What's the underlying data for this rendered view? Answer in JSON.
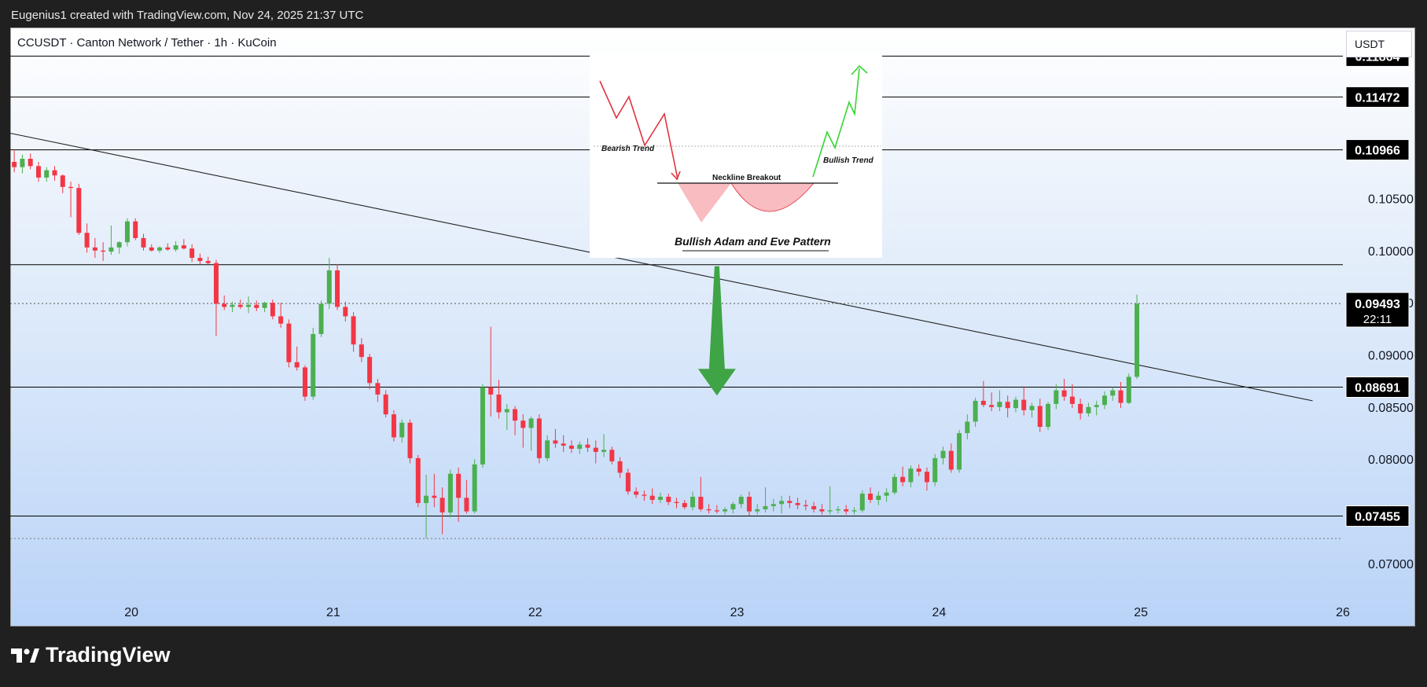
{
  "header": {
    "attribution": "Eugenius1 created with TradingView.com, Nov 24, 2025 21:37 UTC"
  },
  "chart_header": {
    "symbol_line": "CCUSDT · Canton Network / Tether · 1h · KuCoin",
    "currency": "USDT"
  },
  "inset": {
    "bearish_label": "Bearish Trend",
    "bullish_label": "Bullish Trend",
    "neckline_label": "Neckline Breakout",
    "title": "Bullish Adam and Eve Pattern"
  },
  "footer": {
    "brand": "TradingView"
  },
  "chart_data": {
    "type": "candlestick",
    "symbol": "CCUSDT",
    "interval": "1h",
    "exchange": "KuCoin",
    "quote_currency": "USDT",
    "ylim": [
      0.066,
      0.1195
    ],
    "xlim": [
      19.4,
      26.0
    ],
    "y_ticks": [
      0.07,
      0.08,
      0.085,
      0.09,
      0.095,
      0.1,
      0.105
    ],
    "y_tick_labels": [
      "0.07000",
      "0.08000",
      "0.08500",
      "0.09000",
      "0.09500",
      "0.10000",
      "0.10500"
    ],
    "x_ticks": [
      20,
      21,
      22,
      23,
      24,
      25,
      26
    ],
    "x_tick_labels": [
      "20",
      "21",
      "22",
      "23",
      "24",
      "25",
      "26"
    ],
    "horizontal_levels": [
      {
        "price": 0.11864,
        "label": "0.11864"
      },
      {
        "price": 0.11472,
        "label": "0.11472"
      },
      {
        "price": 0.10966,
        "label": "0.10966"
      },
      {
        "price": 0.09865,
        "label": ""
      },
      {
        "price": 0.08691,
        "label": "0.08691"
      },
      {
        "price": 0.07455,
        "label": "0.07455"
      }
    ],
    "current_price": {
      "price": 0.09493,
      "label": "0.09493",
      "countdown": "22:11"
    },
    "trendline": {
      "x1": 19.4,
      "y1": 0.11125,
      "x2": 25.85,
      "y2": 0.0856
    },
    "arrow": {
      "x": 22.9,
      "from": 0.0985,
      "to": 0.0861,
      "color": "#3fa445"
    },
    "colors": {
      "up": "#4caf50",
      "down": "#f23645",
      "level_line": "#000000",
      "arrow": "#3fa445"
    },
    "candles": [
      {
        "t": 19.42,
        "o": 0.1085,
        "h": 0.1096,
        "l": 0.1075,
        "c": 0.108
      },
      {
        "t": 19.46,
        "o": 0.108,
        "h": 0.1092,
        "l": 0.1074,
        "c": 0.1088
      },
      {
        "t": 19.5,
        "o": 0.1088,
        "h": 0.1093,
        "l": 0.1078,
        "c": 0.1081
      },
      {
        "t": 19.54,
        "o": 0.1081,
        "h": 0.1085,
        "l": 0.1066,
        "c": 0.107
      },
      {
        "t": 19.58,
        "o": 0.107,
        "h": 0.108,
        "l": 0.1066,
        "c": 0.1077
      },
      {
        "t": 19.62,
        "o": 0.1077,
        "h": 0.1081,
        "l": 0.1067,
        "c": 0.1072
      },
      {
        "t": 19.66,
        "o": 0.1072,
        "h": 0.1073,
        "l": 0.1055,
        "c": 0.1061
      },
      {
        "t": 19.7,
        "o": 0.1061,
        "h": 0.1066,
        "l": 0.1032,
        "c": 0.106
      },
      {
        "t": 19.74,
        "o": 0.106,
        "h": 0.1064,
        "l": 0.1015,
        "c": 0.1017
      },
      {
        "t": 19.78,
        "o": 0.1017,
        "h": 0.1026,
        "l": 0.0998,
        "c": 0.1003
      },
      {
        "t": 19.82,
        "o": 0.1003,
        "h": 0.1012,
        "l": 0.0993,
        "c": 0.1
      },
      {
        "t": 19.86,
        "o": 0.1,
        "h": 0.1008,
        "l": 0.099,
        "c": 0.0999
      },
      {
        "t": 19.9,
        "o": 0.0999,
        "h": 0.1024,
        "l": 0.0996,
        "c": 0.1003
      },
      {
        "t": 19.94,
        "o": 0.1003,
        "h": 0.1009,
        "l": 0.0997,
        "c": 0.1008
      },
      {
        "t": 19.98,
        "o": 0.1008,
        "h": 0.1031,
        "l": 0.1004,
        "c": 0.1028
      },
      {
        "t": 20.02,
        "o": 0.1028,
        "h": 0.1031,
        "l": 0.101,
        "c": 0.1012
      },
      {
        "t": 20.06,
        "o": 0.1012,
        "h": 0.1016,
        "l": 0.1,
        "c": 0.1003
      },
      {
        "t": 20.1,
        "o": 0.1003,
        "h": 0.1006,
        "l": 0.0999,
        "c": 0.1
      },
      {
        "t": 20.14,
        "o": 0.1,
        "h": 0.1004,
        "l": 0.0998,
        "c": 0.1003
      },
      {
        "t": 20.18,
        "o": 0.1003,
        "h": 0.1007,
        "l": 0.1,
        "c": 0.1001
      },
      {
        "t": 20.22,
        "o": 0.1001,
        "h": 0.1009,
        "l": 0.0999,
        "c": 0.1005
      },
      {
        "t": 20.26,
        "o": 0.1005,
        "h": 0.1011,
        "l": 0.1001,
        "c": 0.1002
      },
      {
        "t": 20.3,
        "o": 0.1002,
        "h": 0.1006,
        "l": 0.0989,
        "c": 0.0993
      },
      {
        "t": 20.34,
        "o": 0.0993,
        "h": 0.0997,
        "l": 0.0987,
        "c": 0.099
      },
      {
        "t": 20.38,
        "o": 0.099,
        "h": 0.0994,
        "l": 0.0987,
        "c": 0.0988
      },
      {
        "t": 20.42,
        "o": 0.0988,
        "h": 0.0991,
        "l": 0.0918,
        "c": 0.0949
      },
      {
        "t": 20.46,
        "o": 0.0949,
        "h": 0.0957,
        "l": 0.0943,
        "c": 0.0946
      },
      {
        "t": 20.5,
        "o": 0.0946,
        "h": 0.0951,
        "l": 0.0941,
        "c": 0.0948
      },
      {
        "t": 20.54,
        "o": 0.0948,
        "h": 0.0953,
        "l": 0.0944,
        "c": 0.0946
      },
      {
        "t": 20.58,
        "o": 0.0946,
        "h": 0.0956,
        "l": 0.094,
        "c": 0.0948
      },
      {
        "t": 20.62,
        "o": 0.0948,
        "h": 0.0952,
        "l": 0.0942,
        "c": 0.0945
      },
      {
        "t": 20.66,
        "o": 0.0945,
        "h": 0.0951,
        "l": 0.0941,
        "c": 0.095
      },
      {
        "t": 20.7,
        "o": 0.095,
        "h": 0.0953,
        "l": 0.0934,
        "c": 0.0937
      },
      {
        "t": 20.74,
        "o": 0.0937,
        "h": 0.095,
        "l": 0.0926,
        "c": 0.093
      },
      {
        "t": 20.78,
        "o": 0.093,
        "h": 0.0934,
        "l": 0.0888,
        "c": 0.0893
      },
      {
        "t": 20.82,
        "o": 0.0893,
        "h": 0.0908,
        "l": 0.0885,
        "c": 0.0888
      },
      {
        "t": 20.86,
        "o": 0.0888,
        "h": 0.089,
        "l": 0.0856,
        "c": 0.086
      },
      {
        "t": 20.9,
        "o": 0.086,
        "h": 0.0926,
        "l": 0.0857,
        "c": 0.092
      },
      {
        "t": 20.94,
        "o": 0.092,
        "h": 0.0952,
        "l": 0.0917,
        "c": 0.0949
      },
      {
        "t": 20.98,
        "o": 0.0949,
        "h": 0.0993,
        "l": 0.0944,
        "c": 0.0981
      },
      {
        "t": 21.02,
        "o": 0.0981,
        "h": 0.0987,
        "l": 0.0943,
        "c": 0.0946
      },
      {
        "t": 21.06,
        "o": 0.0946,
        "h": 0.0951,
        "l": 0.0932,
        "c": 0.0937
      },
      {
        "t": 21.1,
        "o": 0.0937,
        "h": 0.0941,
        "l": 0.0903,
        "c": 0.091
      },
      {
        "t": 21.14,
        "o": 0.091,
        "h": 0.0916,
        "l": 0.0893,
        "c": 0.0898
      },
      {
        "t": 21.18,
        "o": 0.0898,
        "h": 0.0901,
        "l": 0.0867,
        "c": 0.0873
      },
      {
        "t": 21.22,
        "o": 0.0873,
        "h": 0.0877,
        "l": 0.0855,
        "c": 0.0862
      },
      {
        "t": 21.26,
        "o": 0.0862,
        "h": 0.0866,
        "l": 0.084,
        "c": 0.0843
      },
      {
        "t": 21.3,
        "o": 0.0843,
        "h": 0.0847,
        "l": 0.0817,
        "c": 0.0821
      },
      {
        "t": 21.34,
        "o": 0.0821,
        "h": 0.0838,
        "l": 0.0816,
        "c": 0.0835
      },
      {
        "t": 21.38,
        "o": 0.0835,
        "h": 0.0838,
        "l": 0.0796,
        "c": 0.0801
      },
      {
        "t": 21.42,
        "o": 0.0801,
        "h": 0.0804,
        "l": 0.0754,
        "c": 0.0758
      },
      {
        "t": 21.46,
        "o": 0.0758,
        "h": 0.0785,
        "l": 0.0724,
        "c": 0.0765
      },
      {
        "t": 21.5,
        "o": 0.0765,
        "h": 0.0786,
        "l": 0.0754,
        "c": 0.0763
      },
      {
        "t": 21.54,
        "o": 0.0763,
        "h": 0.0773,
        "l": 0.0728,
        "c": 0.0749
      },
      {
        "t": 21.58,
        "o": 0.0749,
        "h": 0.079,
        "l": 0.0744,
        "c": 0.0786
      },
      {
        "t": 21.62,
        "o": 0.0786,
        "h": 0.0792,
        "l": 0.074,
        "c": 0.0763
      },
      {
        "t": 21.66,
        "o": 0.0763,
        "h": 0.078,
        "l": 0.0748,
        "c": 0.075
      },
      {
        "t": 21.7,
        "o": 0.075,
        "h": 0.08,
        "l": 0.0748,
        "c": 0.0795
      },
      {
        "t": 21.74,
        "o": 0.0795,
        "h": 0.0872,
        "l": 0.0792,
        "c": 0.0869
      },
      {
        "t": 21.78,
        "o": 0.0869,
        "h": 0.0927,
        "l": 0.0841,
        "c": 0.0862
      },
      {
        "t": 21.82,
        "o": 0.0862,
        "h": 0.0876,
        "l": 0.0839,
        "c": 0.0845
      },
      {
        "t": 21.86,
        "o": 0.0845,
        "h": 0.0853,
        "l": 0.0828,
        "c": 0.0848
      },
      {
        "t": 21.9,
        "o": 0.0848,
        "h": 0.0851,
        "l": 0.0823,
        "c": 0.0837
      },
      {
        "t": 21.94,
        "o": 0.0837,
        "h": 0.0843,
        "l": 0.0811,
        "c": 0.083
      },
      {
        "t": 21.98,
        "o": 0.083,
        "h": 0.0841,
        "l": 0.0808,
        "c": 0.0839
      },
      {
        "t": 22.02,
        "o": 0.0839,
        "h": 0.0843,
        "l": 0.0796,
        "c": 0.0801
      },
      {
        "t": 22.06,
        "o": 0.0801,
        "h": 0.0823,
        "l": 0.0798,
        "c": 0.0818
      },
      {
        "t": 22.1,
        "o": 0.0818,
        "h": 0.0829,
        "l": 0.0811,
        "c": 0.0815
      },
      {
        "t": 22.14,
        "o": 0.0815,
        "h": 0.0823,
        "l": 0.0807,
        "c": 0.0813
      },
      {
        "t": 22.18,
        "o": 0.0813,
        "h": 0.0818,
        "l": 0.0806,
        "c": 0.081
      },
      {
        "t": 22.22,
        "o": 0.081,
        "h": 0.0817,
        "l": 0.0805,
        "c": 0.0814
      },
      {
        "t": 22.26,
        "o": 0.0814,
        "h": 0.082,
        "l": 0.0807,
        "c": 0.0811
      },
      {
        "t": 22.3,
        "o": 0.0811,
        "h": 0.0818,
        "l": 0.0796,
        "c": 0.0807
      },
      {
        "t": 22.34,
        "o": 0.0807,
        "h": 0.0824,
        "l": 0.0802,
        "c": 0.0809
      },
      {
        "t": 22.38,
        "o": 0.0809,
        "h": 0.0812,
        "l": 0.0795,
        "c": 0.0798
      },
      {
        "t": 22.42,
        "o": 0.0798,
        "h": 0.0802,
        "l": 0.0782,
        "c": 0.0787
      },
      {
        "t": 22.46,
        "o": 0.0787,
        "h": 0.0791,
        "l": 0.0766,
        "c": 0.0769
      },
      {
        "t": 22.5,
        "o": 0.0769,
        "h": 0.0773,
        "l": 0.0763,
        "c": 0.0766
      },
      {
        "t": 22.54,
        "o": 0.0766,
        "h": 0.077,
        "l": 0.076,
        "c": 0.0765
      },
      {
        "t": 22.58,
        "o": 0.0765,
        "h": 0.0772,
        "l": 0.0757,
        "c": 0.0761
      },
      {
        "t": 22.62,
        "o": 0.0761,
        "h": 0.0768,
        "l": 0.0758,
        "c": 0.0764
      },
      {
        "t": 22.66,
        "o": 0.0764,
        "h": 0.0767,
        "l": 0.0756,
        "c": 0.0759
      },
      {
        "t": 22.7,
        "o": 0.0759,
        "h": 0.0763,
        "l": 0.0753,
        "c": 0.0758
      },
      {
        "t": 22.74,
        "o": 0.0758,
        "h": 0.0761,
        "l": 0.0752,
        "c": 0.0754
      },
      {
        "t": 22.78,
        "o": 0.0754,
        "h": 0.0769,
        "l": 0.0751,
        "c": 0.0764
      },
      {
        "t": 22.82,
        "o": 0.0764,
        "h": 0.0783,
        "l": 0.075,
        "c": 0.0752
      },
      {
        "t": 22.86,
        "o": 0.0752,
        "h": 0.0757,
        "l": 0.0748,
        "c": 0.0751
      },
      {
        "t": 22.9,
        "o": 0.0751,
        "h": 0.0756,
        "l": 0.0748,
        "c": 0.075
      },
      {
        "t": 22.94,
        "o": 0.075,
        "h": 0.0754,
        "l": 0.0747,
        "c": 0.0752
      },
      {
        "t": 22.98,
        "o": 0.0752,
        "h": 0.0759,
        "l": 0.0748,
        "c": 0.0757
      },
      {
        "t": 23.02,
        "o": 0.0757,
        "h": 0.0766,
        "l": 0.0753,
        "c": 0.0764
      },
      {
        "t": 23.06,
        "o": 0.0764,
        "h": 0.0769,
        "l": 0.0746,
        "c": 0.075
      },
      {
        "t": 23.1,
        "o": 0.075,
        "h": 0.0757,
        "l": 0.0747,
        "c": 0.0752
      },
      {
        "t": 23.14,
        "o": 0.0752,
        "h": 0.0773,
        "l": 0.0749,
        "c": 0.0755
      },
      {
        "t": 23.18,
        "o": 0.0755,
        "h": 0.0762,
        "l": 0.075,
        "c": 0.0757
      },
      {
        "t": 23.22,
        "o": 0.0757,
        "h": 0.0765,
        "l": 0.0748,
        "c": 0.076
      },
      {
        "t": 23.26,
        "o": 0.076,
        "h": 0.0765,
        "l": 0.0753,
        "c": 0.0758
      },
      {
        "t": 23.3,
        "o": 0.0758,
        "h": 0.0763,
        "l": 0.0752,
        "c": 0.0756
      },
      {
        "t": 23.34,
        "o": 0.0756,
        "h": 0.0761,
        "l": 0.0751,
        "c": 0.0755
      },
      {
        "t": 23.38,
        "o": 0.0755,
        "h": 0.0759,
        "l": 0.0749,
        "c": 0.0752
      },
      {
        "t": 23.42,
        "o": 0.0752,
        "h": 0.0757,
        "l": 0.0747,
        "c": 0.075
      },
      {
        "t": 23.46,
        "o": 0.075,
        "h": 0.0774,
        "l": 0.0747,
        "c": 0.0751
      },
      {
        "t": 23.5,
        "o": 0.0751,
        "h": 0.0755,
        "l": 0.0748,
        "c": 0.0752
      },
      {
        "t": 23.54,
        "o": 0.0752,
        "h": 0.0756,
        "l": 0.0747,
        "c": 0.075
      },
      {
        "t": 23.58,
        "o": 0.075,
        "h": 0.0754,
        "l": 0.0747,
        "c": 0.0751
      },
      {
        "t": 23.62,
        "o": 0.0751,
        "h": 0.077,
        "l": 0.0749,
        "c": 0.0767
      },
      {
        "t": 23.66,
        "o": 0.0767,
        "h": 0.0773,
        "l": 0.0758,
        "c": 0.0761
      },
      {
        "t": 23.7,
        "o": 0.0761,
        "h": 0.0769,
        "l": 0.0756,
        "c": 0.0765
      },
      {
        "t": 23.74,
        "o": 0.0765,
        "h": 0.0772,
        "l": 0.0759,
        "c": 0.0768
      },
      {
        "t": 23.78,
        "o": 0.0768,
        "h": 0.0786,
        "l": 0.0766,
        "c": 0.0783
      },
      {
        "t": 23.82,
        "o": 0.0783,
        "h": 0.0793,
        "l": 0.0774,
        "c": 0.0778
      },
      {
        "t": 23.86,
        "o": 0.0778,
        "h": 0.0794,
        "l": 0.0773,
        "c": 0.0791
      },
      {
        "t": 23.9,
        "o": 0.0791,
        "h": 0.0795,
        "l": 0.0784,
        "c": 0.0788
      },
      {
        "t": 23.94,
        "o": 0.0788,
        "h": 0.0792,
        "l": 0.077,
        "c": 0.0778
      },
      {
        "t": 23.98,
        "o": 0.0778,
        "h": 0.0805,
        "l": 0.0774,
        "c": 0.0801
      },
      {
        "t": 24.02,
        "o": 0.0801,
        "h": 0.0812,
        "l": 0.0795,
        "c": 0.0808
      },
      {
        "t": 24.06,
        "o": 0.0808,
        "h": 0.0815,
        "l": 0.0787,
        "c": 0.079
      },
      {
        "t": 24.1,
        "o": 0.079,
        "h": 0.0828,
        "l": 0.0787,
        "c": 0.0825
      },
      {
        "t": 24.14,
        "o": 0.0825,
        "h": 0.0843,
        "l": 0.0819,
        "c": 0.0836
      },
      {
        "t": 24.18,
        "o": 0.0836,
        "h": 0.0859,
        "l": 0.0831,
        "c": 0.0856
      },
      {
        "t": 24.22,
        "o": 0.0856,
        "h": 0.0875,
        "l": 0.085,
        "c": 0.0852
      },
      {
        "t": 24.26,
        "o": 0.0852,
        "h": 0.0864,
        "l": 0.0846,
        "c": 0.085
      },
      {
        "t": 24.3,
        "o": 0.085,
        "h": 0.0866,
        "l": 0.0846,
        "c": 0.0855
      },
      {
        "t": 24.34,
        "o": 0.0855,
        "h": 0.0861,
        "l": 0.084,
        "c": 0.0849
      },
      {
        "t": 24.38,
        "o": 0.0849,
        "h": 0.086,
        "l": 0.0845,
        "c": 0.0857
      },
      {
        "t": 24.42,
        "o": 0.0857,
        "h": 0.087,
        "l": 0.0842,
        "c": 0.0847
      },
      {
        "t": 24.46,
        "o": 0.0847,
        "h": 0.0854,
        "l": 0.084,
        "c": 0.0851
      },
      {
        "t": 24.5,
        "o": 0.0851,
        "h": 0.0858,
        "l": 0.0826,
        "c": 0.0831
      },
      {
        "t": 24.54,
        "o": 0.0831,
        "h": 0.0855,
        "l": 0.0828,
        "c": 0.0853
      },
      {
        "t": 24.58,
        "o": 0.0853,
        "h": 0.0872,
        "l": 0.0848,
        "c": 0.0866
      },
      {
        "t": 24.62,
        "o": 0.0866,
        "h": 0.0877,
        "l": 0.0856,
        "c": 0.086
      },
      {
        "t": 24.66,
        "o": 0.086,
        "h": 0.0872,
        "l": 0.0849,
        "c": 0.0853
      },
      {
        "t": 24.7,
        "o": 0.0853,
        "h": 0.0858,
        "l": 0.0838,
        "c": 0.0844
      },
      {
        "t": 24.74,
        "o": 0.0844,
        "h": 0.0854,
        "l": 0.0841,
        "c": 0.085
      },
      {
        "t": 24.78,
        "o": 0.085,
        "h": 0.0856,
        "l": 0.0842,
        "c": 0.0852
      },
      {
        "t": 24.82,
        "o": 0.0852,
        "h": 0.0865,
        "l": 0.0848,
        "c": 0.0861
      },
      {
        "t": 24.86,
        "o": 0.0861,
        "h": 0.0869,
        "l": 0.0856,
        "c": 0.0866
      },
      {
        "t": 24.9,
        "o": 0.0866,
        "h": 0.0874,
        "l": 0.0849,
        "c": 0.0854
      },
      {
        "t": 24.94,
        "o": 0.0854,
        "h": 0.0882,
        "l": 0.0853,
        "c": 0.0879
      },
      {
        "t": 24.98,
        "o": 0.0879,
        "h": 0.0958,
        "l": 0.0877,
        "c": 0.0949
      }
    ]
  }
}
